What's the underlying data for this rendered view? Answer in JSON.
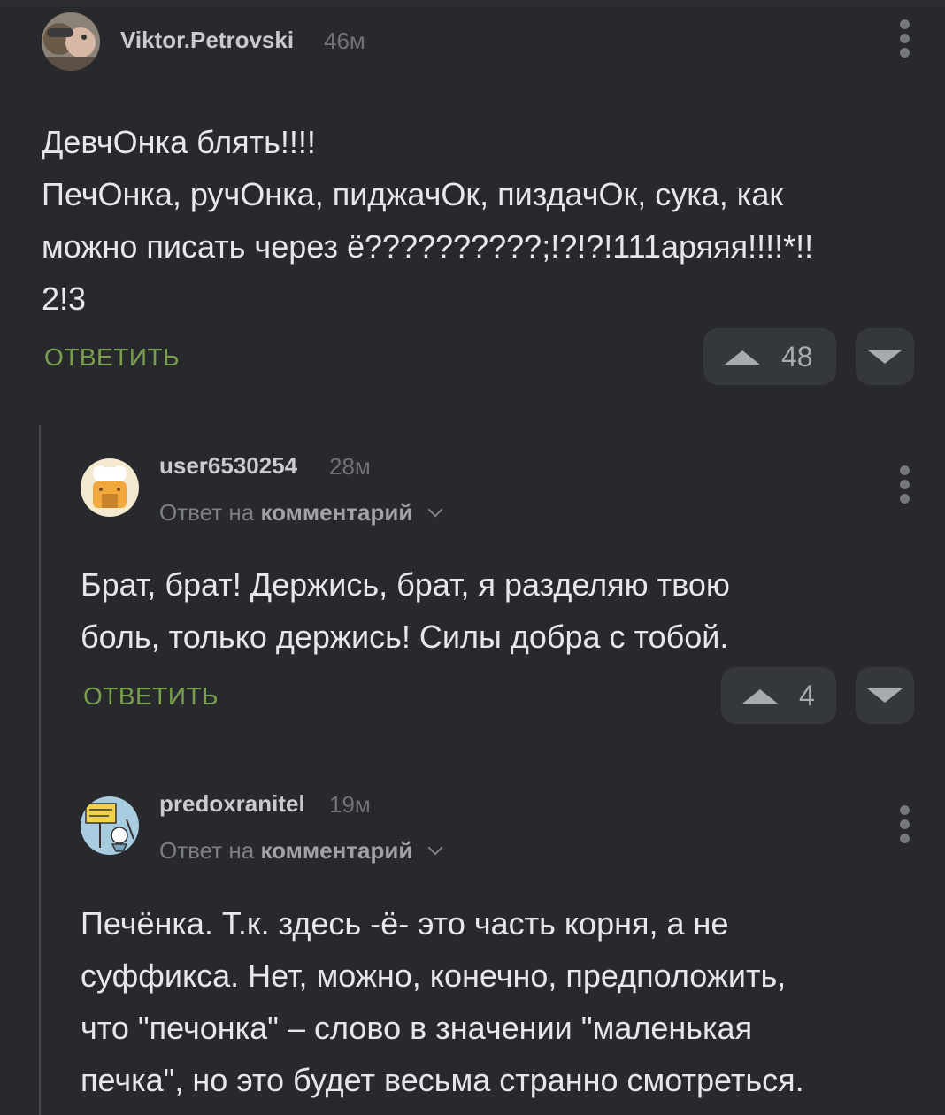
{
  "comments": [
    {
      "username": "Viktor.Petrovski",
      "time": "46м",
      "avatar_icon": "user-photo-avatar",
      "lines": [
        "ДевчОнка блять!!!!",
        "ПечОнка, ручОнка, пиджачОк, пиздачОк, сука, как",
        "можно писать через ё??????????;!?!?!111аряяя!!!!*!!",
        "2!3"
      ],
      "reply_label": "ОТВЕТИТЬ",
      "votes": "48"
    },
    {
      "username": "user6530254",
      "time": "28м",
      "avatar_icon": "chef-hat-avatar",
      "reply_to_prefix": "Ответ на",
      "reply_to_target": "комментарий",
      "lines": [
        "Брат, брат! Держись, брат, я разделяю твою",
        "боль, только держись! Силы добра с тобой."
      ],
      "reply_label": "ОТВЕТИТЬ",
      "votes": "4"
    },
    {
      "username": "predoxranitel",
      "time": "19м",
      "avatar_icon": "cartoon-sign-avatar",
      "reply_to_prefix": "Ответ на",
      "reply_to_target": "комментарий",
      "lines": [
        "Печёнка. Т.к. здесь -ё- это часть корня, а не",
        "суффикса. Нет, можно, конечно, предположить,",
        "что \"печонка\" – слово в значении \"маленькая",
        "печка\", но это будет весьма странно смотреться."
      ]
    }
  ],
  "colors": {
    "background": "#27292c",
    "reply_accent": "#7a9e4e",
    "vote_button_bg": "#34373b"
  }
}
